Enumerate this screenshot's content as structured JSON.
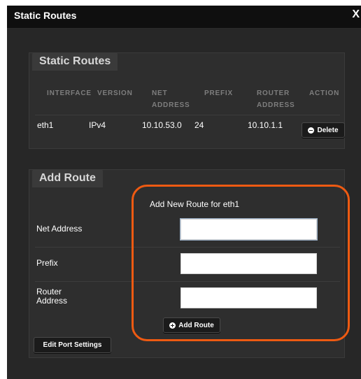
{
  "dialog": {
    "title": "Static Routes",
    "close_glyph": "X"
  },
  "static_routes": {
    "legend": "Static Routes",
    "headers": {
      "interface": "INTERFACE",
      "version": "VERSION",
      "net_1": "NET",
      "net_2": "ADDRESS",
      "prefix": "PREFIX",
      "router_1": "ROUTER",
      "router_2": "ADDRESS",
      "action": "ACTION"
    },
    "rows": [
      {
        "interface": "eth1",
        "version": "IPv4",
        "net_address": "10.10.53.0",
        "prefix": "24",
        "router_address": "10.10.1.1",
        "action": "Delete"
      }
    ]
  },
  "add_route": {
    "legend": "Add Route",
    "subtitle": "Add New Route for eth1",
    "fields": {
      "net_address": {
        "label": "Net Address",
        "value": ""
      },
      "prefix": {
        "label": "Prefix",
        "value": ""
      },
      "router_address": {
        "label_1": "Router",
        "label_2": "Address",
        "value": ""
      }
    },
    "add_button": "Add Route",
    "edit_button": "Edit Port Settings"
  },
  "colors": {
    "highlight": "#ee5a12",
    "dialog_bg": "#232323",
    "panel_bg": "#2e2e2e"
  }
}
